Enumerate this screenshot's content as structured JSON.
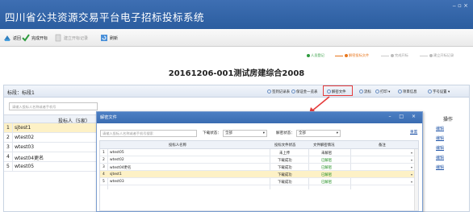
{
  "window": {
    "title": "四川省公共资源交易平台电子招标投标系统",
    "controls": "‒ ▫ ×"
  },
  "toolbar": {
    "return_label": "返回",
    "finish_open_label": "完成开标",
    "create_record_label": "建立开标记录",
    "refresh_label": "刷新"
  },
  "progress": {
    "steps": [
      {
        "label": "人员登记",
        "color": "#2e9b3e"
      },
      {
        "label": "解密投标文件",
        "color": "#e8761d"
      },
      {
        "label": "完成开标",
        "color": "#bbbbbb"
      },
      {
        "label": "建立开标记录",
        "color": "#bbbbbb"
      }
    ]
  },
  "project": {
    "title": "20161206-001测试房建综合2008"
  },
  "section": {
    "label": "标段：标段1",
    "buttons": [
      "签到记录表",
      "保证金一览表",
      "解密文件",
      "流标",
      "打印 ▾",
      "项目信息",
      "字号设置 ▾"
    ]
  },
  "main_search": {
    "placeholder": "请输入投标人名称或者手机号"
  },
  "main_table": {
    "header": "投标人（5家）",
    "rows": [
      {
        "n": "1",
        "name": "sjtest1"
      },
      {
        "n": "2",
        "name": "wtest02"
      },
      {
        "n": "3",
        "name": "wtest03"
      },
      {
        "n": "4",
        "name": "wtest04更名"
      },
      {
        "n": "5",
        "name": "wtest05"
      }
    ]
  },
  "ops": {
    "header": "操作",
    "link": "编辑"
  },
  "dialog": {
    "title": "解密文件",
    "controls": "– □ ×",
    "search_placeholder": "请输入投标人名称或者手机号搜索",
    "download_label": "下载状态：",
    "download_value": "全部",
    "decrypt_label": "解密状态：",
    "decrypt_value": "全部",
    "reset_label": "重置",
    "columns": [
      "投标人名称",
      "投标文件状态",
      "文件解密情况",
      "备注"
    ],
    "rows": [
      {
        "n": "1",
        "name": "wtest05",
        "file": "未上传",
        "decrypt": "未解密"
      },
      {
        "n": "2",
        "name": "wtest02",
        "file": "下载成功",
        "decrypt": "已解密"
      },
      {
        "n": "3",
        "name": "wtest04更名",
        "file": "下载成功",
        "decrypt": "已解密"
      },
      {
        "n": "4",
        "name": "sjtest1",
        "file": "下载成功",
        "decrypt": "已解密"
      },
      {
        "n": "5",
        "name": "wtest03",
        "file": "下载成功",
        "decrypt": "已解密"
      }
    ]
  },
  "colors": {
    "accent": "#3a6cb1",
    "highlight_box": "#e53c3c",
    "success": "#1a8a1a"
  }
}
